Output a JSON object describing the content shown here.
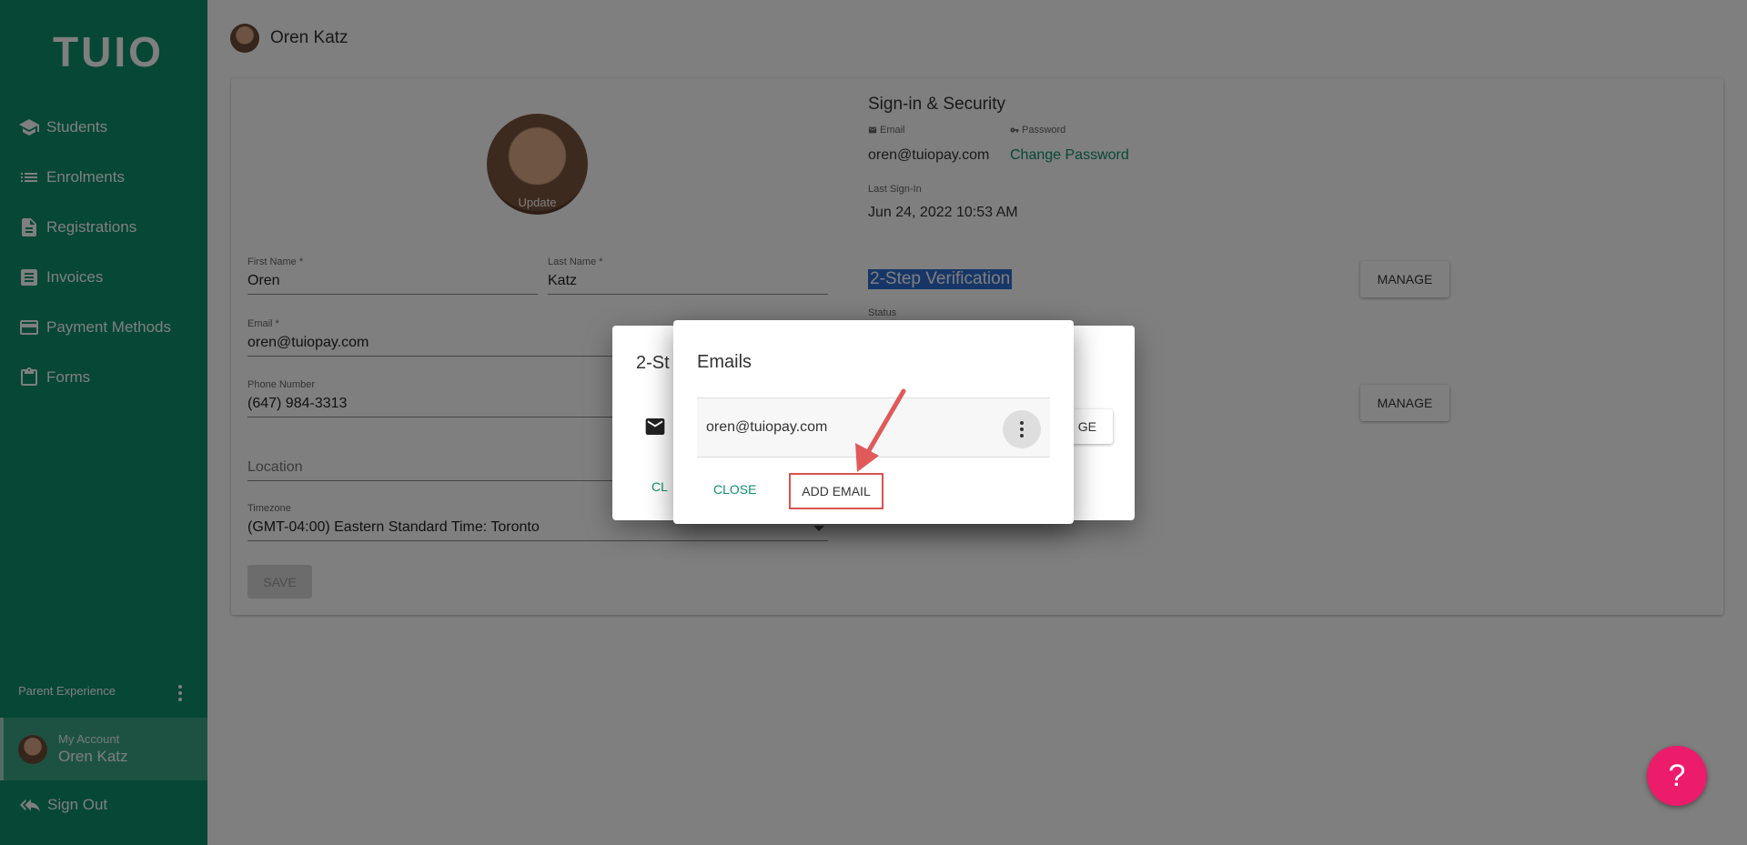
{
  "app": {
    "logo": "TUIO"
  },
  "sidebar": {
    "items": [
      {
        "label": "Students",
        "icon": "school-icon"
      },
      {
        "label": "Enrolments",
        "icon": "list-icon"
      },
      {
        "label": "Registrations",
        "icon": "document-icon"
      },
      {
        "label": "Invoices",
        "icon": "invoice-icon"
      },
      {
        "label": "Payment Methods",
        "icon": "credit-card-icon"
      },
      {
        "label": "Forms",
        "icon": "clipboard-icon"
      }
    ],
    "parent_experience": "Parent Experience",
    "account": {
      "label": "My Account",
      "name": "Oren Katz"
    },
    "sign_out": "Sign Out"
  },
  "header": {
    "name": "Oren Katz"
  },
  "profile": {
    "update_label": "Update",
    "first_name": {
      "label": "First Name *",
      "value": "Oren"
    },
    "last_name": {
      "label": "Last Name *",
      "value": "Katz"
    },
    "email": {
      "label": "Email *",
      "value": "oren@tuiopay.com"
    },
    "phone": {
      "label": "Phone Number",
      "value": "(647) 984-3313"
    },
    "location": {
      "placeholder": "Location"
    },
    "timezone": {
      "label": "Timezone",
      "value": "(GMT-04:00) Eastern Standard Time: Toronto"
    },
    "save_label": "SAVE"
  },
  "security": {
    "title": "Sign-in & Security",
    "email_label": "Email",
    "email_value": "oren@tuiopay.com",
    "password_label": "Password",
    "change_password": "Change Password",
    "last_signin_label": "Last Sign-In",
    "last_signin_value": "Jun 24, 2022 10:53 AM",
    "two_step_title": "2-Step Verification",
    "status_label": "Status",
    "manage_label": "MANAGE"
  },
  "back_dialog": {
    "title_fragment": "2-St",
    "close_fragment": "CL",
    "button_fragment": "GE"
  },
  "emails_dialog": {
    "title": "Emails",
    "emails": [
      "oren@tuiopay.com"
    ],
    "close_label": "CLOSE",
    "add_label": "ADD EMAIL"
  },
  "help": {
    "label": "?"
  },
  "colors": {
    "brand": "#0f8f6b",
    "help": "#ec1c6b",
    "highlight": "#d9534f"
  }
}
